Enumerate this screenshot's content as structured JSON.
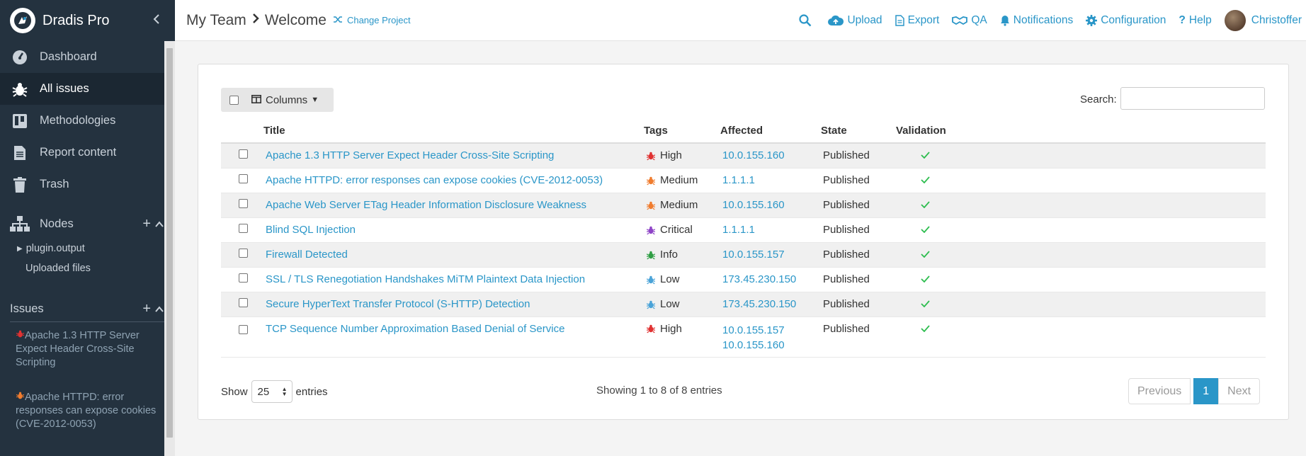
{
  "app": {
    "brand": "Dradis Pro"
  },
  "sidebar": {
    "nav": [
      {
        "label": "Dashboard",
        "icon": "dashboard-icon"
      },
      {
        "label": "All issues",
        "icon": "bug-icon"
      },
      {
        "label": "Methodologies",
        "icon": "board-icon"
      },
      {
        "label": "Report content",
        "icon": "file-icon"
      },
      {
        "label": "Trash",
        "icon": "trash-icon"
      }
    ],
    "nodes_label": "Nodes",
    "node_items": [
      "plugin.output",
      "Uploaded files"
    ],
    "issues_label": "Issues",
    "issue_links": [
      {
        "label": "Apache 1.3 HTTP Server Expect Header Cross-Site Scripting",
        "color": "#e03131"
      },
      {
        "label": "Apache HTTPD: error responses can expose cookies (CVE-2012-0053)",
        "color": "#f07c2e"
      }
    ]
  },
  "header": {
    "breadcrumb": [
      "My Team",
      "Welcome"
    ],
    "change_project": "Change Project",
    "actions": [
      {
        "label": "",
        "icon": "search-icon"
      },
      {
        "label": "Upload",
        "icon": "cloud-upload-icon"
      },
      {
        "label": "Export",
        "icon": "file-export-icon"
      },
      {
        "label": "QA",
        "icon": "handshake-icon"
      },
      {
        "label": "Notifications",
        "icon": "bell-icon"
      },
      {
        "label": "Configuration",
        "icon": "gear-icon"
      },
      {
        "label": "Help",
        "icon": "help-icon"
      }
    ],
    "user": "Christoffer"
  },
  "table": {
    "columns_button": "Columns",
    "search_label": "Search:",
    "headers": [
      "Title",
      "Tags",
      "Affected",
      "State",
      "Validation"
    ],
    "rows": [
      {
        "title": "Apache 1.3 HTTP Server Expect Header Cross-Site Scripting",
        "tag": "High",
        "tag_color": "#e03131",
        "affected": [
          "10.0.155.160"
        ],
        "state": "Published"
      },
      {
        "title": "Apache HTTPD: error responses can expose cookies (CVE-2012-0053)",
        "tag": "Medium",
        "tag_color": "#f07c2e",
        "affected": [
          "1.1.1.1"
        ],
        "state": "Published"
      },
      {
        "title": "Apache Web Server ETag Header Information Disclosure Weakness",
        "tag": "Medium",
        "tag_color": "#f07c2e",
        "affected": [
          "10.0.155.160"
        ],
        "state": "Published"
      },
      {
        "title": "Blind SQL Injection",
        "tag": "Critical",
        "tag_color": "#8e44c7",
        "affected": [
          "1.1.1.1"
        ],
        "state": "Published"
      },
      {
        "title": "Firewall Detected",
        "tag": "Info",
        "tag_color": "#2f9e44",
        "affected": [
          "10.0.155.157"
        ],
        "state": "Published"
      },
      {
        "title": "SSL / TLS Renegotiation Handshakes MiTM Plaintext Data Injection",
        "tag": "Low",
        "tag_color": "#4aa3d8",
        "affected": [
          "173.45.230.150"
        ],
        "state": "Published"
      },
      {
        "title": "Secure HyperText Transfer Protocol (S-HTTP) Detection",
        "tag": "Low",
        "tag_color": "#4aa3d8",
        "affected": [
          "173.45.230.150"
        ],
        "state": "Published"
      },
      {
        "title": "TCP Sequence Number Approximation Based Denial of Service",
        "tag": "High",
        "tag_color": "#e03131",
        "affected": [
          "10.0.155.157",
          "10.0.155.160"
        ],
        "state": "Published"
      }
    ],
    "show_label": "Show",
    "entries_value": "25",
    "entries_label": "entries",
    "info": "Showing 1 to 8 of 8 entries",
    "pagination": {
      "previous": "Previous",
      "current": "1",
      "next": "Next"
    }
  },
  "colors": {
    "accent": "#2a96c8",
    "sidebar_bg": "#24323f",
    "check": "#2ebd4f"
  }
}
